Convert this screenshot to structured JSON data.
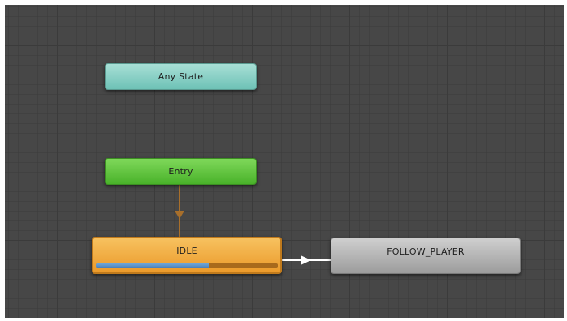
{
  "graph": {
    "nodes": {
      "any_state": {
        "label": "Any State",
        "color": "#8fd1c7"
      },
      "entry": {
        "label": "Entry",
        "color": "#5cc13a"
      },
      "idle": {
        "label": "IDLE",
        "color": "#f0aa3e",
        "progress": 0.62,
        "progress_color": "#5b92c8"
      },
      "follow_player": {
        "label": "FOLLOW_PLAYER",
        "color": "#b5b5b5"
      }
    },
    "transitions": [
      {
        "from": "Entry",
        "to": "IDLE",
        "color": "#a86f2b"
      },
      {
        "from": "IDLE",
        "to": "FOLLOW_PLAYER",
        "color": "#ffffff"
      }
    ]
  }
}
